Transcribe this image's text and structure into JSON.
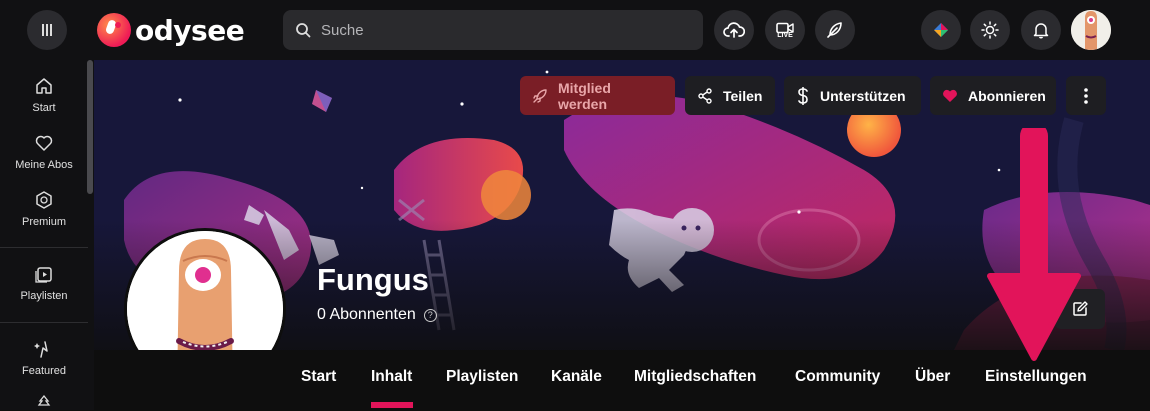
{
  "header": {
    "logo_text": "odysee",
    "search_placeholder": "Suche",
    "live_label": "LIVE"
  },
  "sidebar": {
    "items": [
      {
        "label": "Start",
        "icon": "home-icon"
      },
      {
        "label": "Meine Abos",
        "icon": "heart-icon"
      },
      {
        "label": "Premium",
        "icon": "premium-icon"
      },
      {
        "label": "Playlisten",
        "icon": "playlist-icon"
      },
      {
        "label": "Featured",
        "icon": "featured-icon"
      }
    ]
  },
  "actions": {
    "member": "Mitglied werden",
    "share": "Teilen",
    "support": "Unterstützen",
    "subscribe": "Abonnieren"
  },
  "channel": {
    "name": "Fungus",
    "subscribers": "0 Abonnenten",
    "help_glyph": "?"
  },
  "tabs": [
    {
      "label": "Start"
    },
    {
      "label": "Inhalt",
      "active": true
    },
    {
      "label": "Playlisten"
    },
    {
      "label": "Kanäle"
    },
    {
      "label": "Mitgliedschaften"
    },
    {
      "label": "Community"
    },
    {
      "label": "Über"
    },
    {
      "label": "Einstellungen"
    }
  ],
  "colors": {
    "accent": "#e2145a",
    "background": "#0e0e0e",
    "header": "#111113",
    "member_button": "#7a1e26"
  }
}
